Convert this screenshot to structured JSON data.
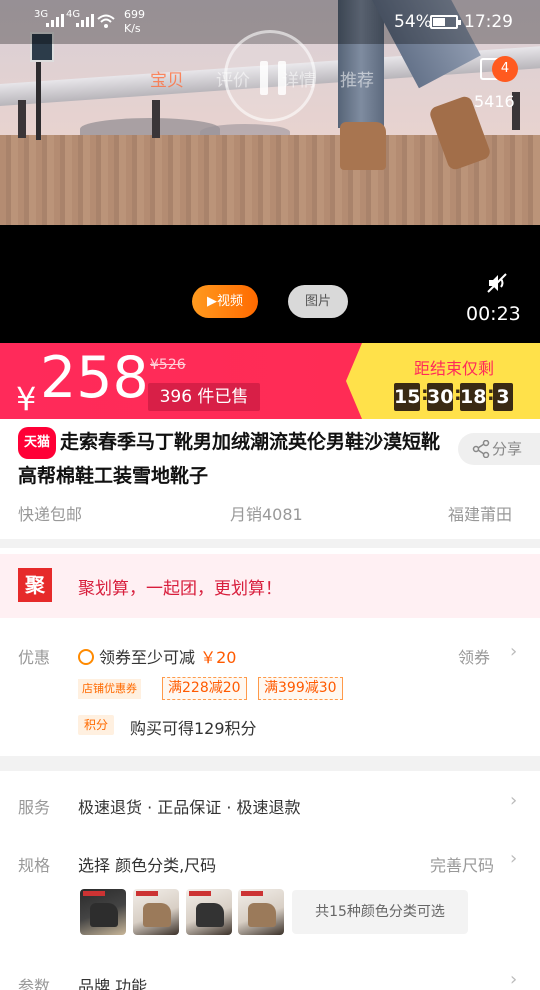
{
  "status_bar": {
    "sim1": "3G",
    "sim2": "4G",
    "speed_value": "699",
    "speed_unit": "K/s",
    "battery": "54%",
    "time": "17:29"
  },
  "nav_tabs": [
    "宝贝",
    "评价",
    "详情",
    "推荐"
  ],
  "cart": {
    "badge": "4",
    "count": "5416"
  },
  "video": {
    "video_label": "视频",
    "picture_label": "图片",
    "duration": "00:23"
  },
  "price": {
    "currency": "¥",
    "current": "258",
    "original": "¥526",
    "sold": "396 件已售",
    "countdown_label": "距结束仅剩",
    "countdown": [
      "15",
      "30",
      "18",
      "3"
    ]
  },
  "product": {
    "tmall_badge": "天猫",
    "title": "走索春季马丁靴男加绒潮流英伦男鞋沙漠短靴高帮棉鞋工装雪地靴子",
    "share": "分享",
    "shipping": "快递包邮",
    "monthly_sales": "月销4081",
    "location": "福建莆田"
  },
  "juhuasuan": {
    "logo": "聚",
    "text": "聚划算，一起团，更划算！"
  },
  "offers": {
    "label": "优惠",
    "coupon_text": "领券至少可减",
    "coupon_amount": "￥20",
    "collect": "领券",
    "shop_tag": "店铺优惠券",
    "coupon_tags": [
      "满228减20",
      "满399减30"
    ],
    "points_tag": "积分",
    "points_text": "购买可得129积分"
  },
  "service": {
    "label": "服务",
    "text": "极速退货 · 正品保证 · 极速退款"
  },
  "spec": {
    "label": "规格",
    "text": "选择 颜色分类,尺码",
    "right": "完善尺码",
    "more": "共15种颜色分类可选"
  },
  "params": {
    "label": "参数",
    "text": "品牌 功能"
  }
}
